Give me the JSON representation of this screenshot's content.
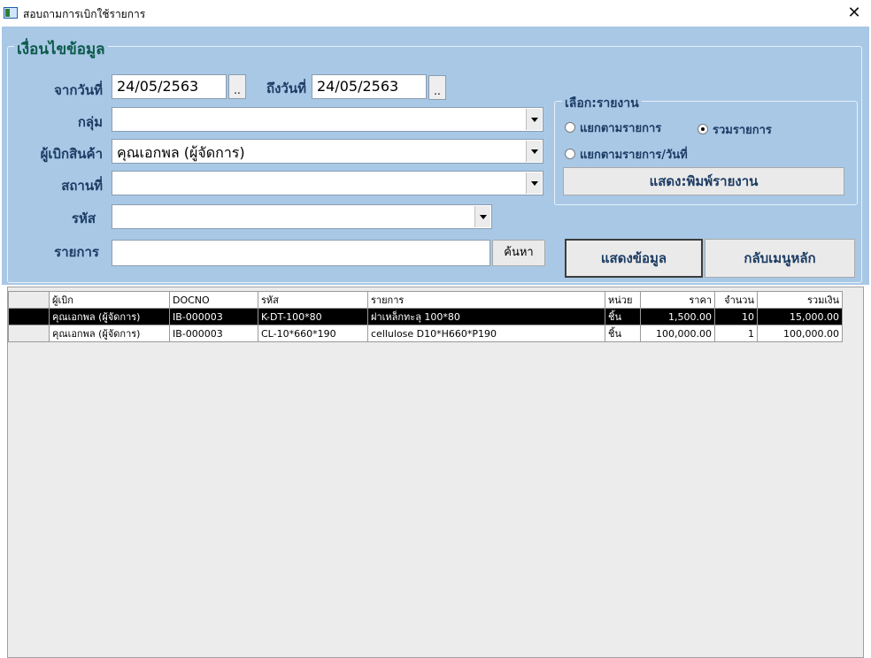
{
  "window": {
    "title": "สอบถามการเบิกใช้รายการ",
    "close_glyph": "✕"
  },
  "criteria": {
    "legend": "เงื่อนไขข้อมูล",
    "from_date_label": "จากวันที่",
    "from_date": "24/05/2563",
    "to_date_label": "ถึงวันที่",
    "to_date": "24/05/2563",
    "picker_label": "..",
    "group_label": "กลุ่ม",
    "group_value": "",
    "requester_label": "ผู้เบิกสินค้า",
    "requester_value": "คุณเอกพล (ผู้จัดการ)",
    "location_label": "สถานที่",
    "location_value": "",
    "code_label": "รหัส",
    "code_value": "",
    "item_label": "รายการ",
    "item_value": "",
    "search_button": "ค้นหา"
  },
  "report": {
    "legend": "เลือก:รายงาน",
    "options": [
      {
        "label": "แยกตามรายการ",
        "selected": false
      },
      {
        "label": "รวมรายการ",
        "selected": true
      },
      {
        "label": "แยกตามรายการ/วันที่",
        "selected": false
      }
    ],
    "print_button": "แสดง:พิมพ์รายงาน"
  },
  "actions": {
    "show_data": "แสดงข้อมูล",
    "back_menu": "กลับเมนูหลัก"
  },
  "grid": {
    "columns": [
      "ผู้เบิก",
      "DOCNO",
      "รหัส",
      "รายการ",
      "หน่วย",
      "ราคา",
      "จำนวน",
      "รวมเงิน"
    ],
    "rows": [
      {
        "requester": "คุณเอกพล (ผู้จัดการ)",
        "docno": "IB-000003",
        "code": "K-DT-100*80",
        "item": "ฝาเหล็กทะลุ 100*80",
        "unit": "ชิ้น",
        "price": "1,500.00",
        "qty": "10",
        "total": "15,000.00",
        "selected": true
      },
      {
        "requester": "คุณเอกพล (ผู้จัดการ)",
        "docno": "IB-000003",
        "code": "CL-10*660*190",
        "item": "cellulose D10*H660*P190",
        "unit": "ชิ้น",
        "price": "100,000.00",
        "qty": "1",
        "total": "100,000.00",
        "selected": false
      }
    ]
  }
}
